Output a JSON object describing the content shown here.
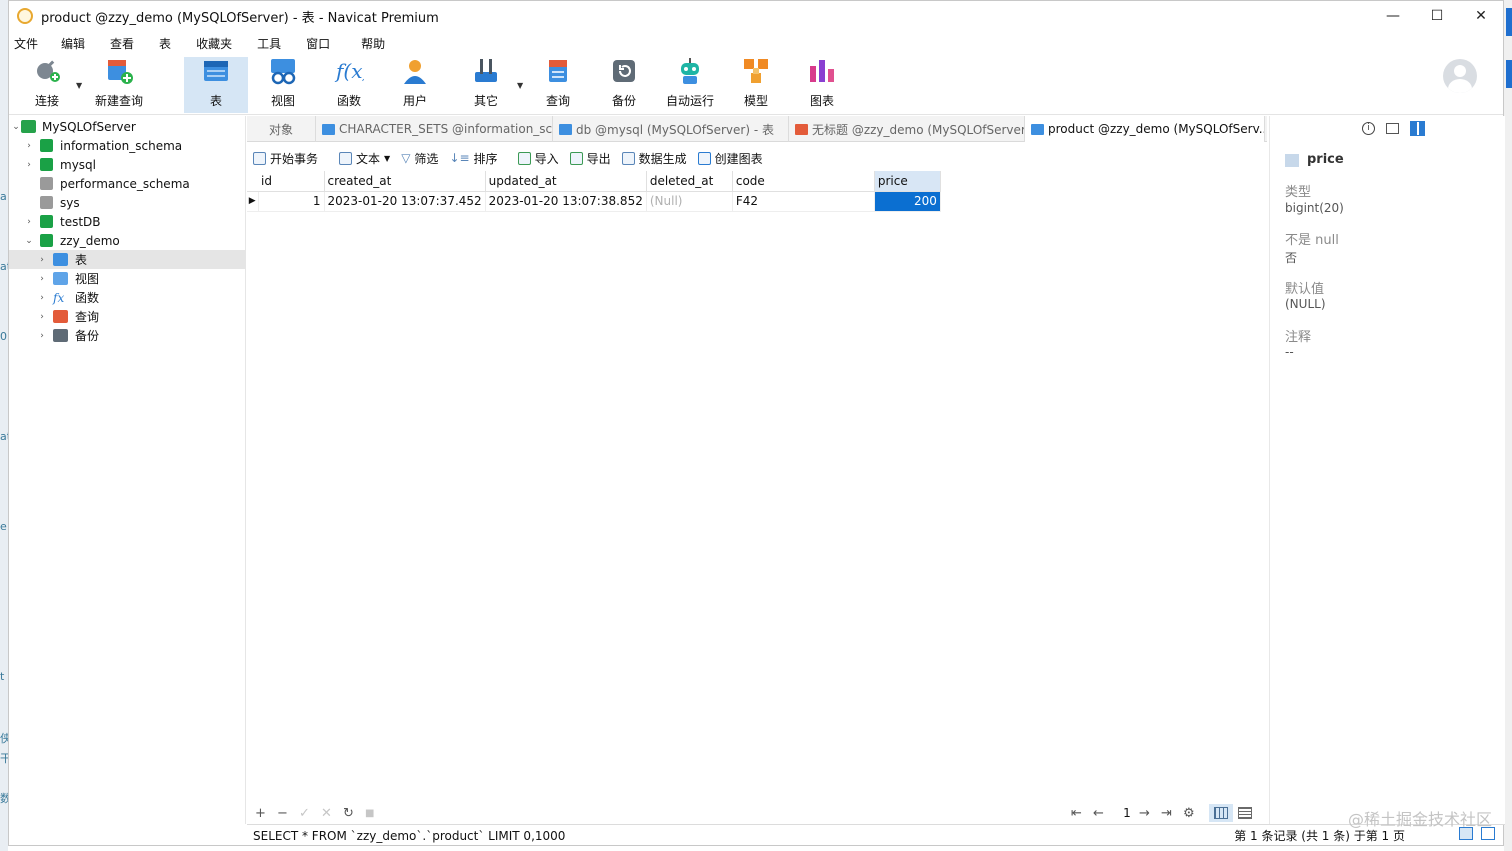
{
  "window": {
    "title": "product @zzy_demo (MySQLOfServer) - 表 - Navicat Premium",
    "minimize": "—",
    "maximize": "☐",
    "close": "✕"
  },
  "menu": [
    "文件",
    "编辑",
    "查看",
    "表",
    "收藏夹",
    "工具",
    "窗口",
    "帮助"
  ],
  "toolbar": {
    "connect": "连接",
    "new_query": "新建查询",
    "table": "表",
    "view": "视图",
    "function": "函数",
    "user": "用户",
    "other": "其它",
    "query": "查询",
    "backup": "备份",
    "auto_run": "自动运行",
    "model": "模型",
    "chart": "图表"
  },
  "tree": {
    "server": "MySQLOfServer",
    "databases": [
      "information_schema",
      "mysql",
      "performance_schema",
      "sys",
      "testDB",
      "zzy_demo"
    ],
    "children": [
      "表",
      "视图",
      "函数",
      "查询",
      "备份"
    ]
  },
  "tabs": [
    "对象",
    "CHARACTER_SETS @information_sch...",
    "db @mysql (MySQLOfServer) - 表",
    "无标题 @zzy_demo (MySQLOfServer)...",
    "product @zzy_demo (MySQLOfServ..."
  ],
  "subtoolbar": {
    "begin_tx": "开始事务",
    "text": "文本",
    "filter": "筛选",
    "sort": "排序",
    "import": "导入",
    "export": "导出",
    "data_gen": "数据生成",
    "create_chart": "创建图表"
  },
  "grid": {
    "columns": [
      "id",
      "created_at",
      "updated_at",
      "deleted_at",
      "code",
      "price"
    ],
    "rows": [
      [
        "1",
        "2023-01-20 13:07:37.452",
        "2023-01-20 13:07:38.852",
        "(Null)",
        "F42",
        "200"
      ]
    ]
  },
  "nav": {
    "add": "+",
    "remove": "−",
    "apply": "✓",
    "discard": "✕",
    "refresh": "↻",
    "stop": "■",
    "first": "⇤",
    "prev": "←",
    "page": "1",
    "next": "→",
    "last": "⇥",
    "settings": "⚙"
  },
  "status": {
    "sql": "SELECT * FROM `zzy_demo`.`product` LIMIT 0,1000",
    "record_info": "第 1 条记录 (共 1 条) 于第 1 页"
  },
  "right_panel": {
    "field_name": "price",
    "type_label": "类型",
    "type_value": "bigint(20)",
    "notnull_label": "不是 null",
    "notnull_value": "否",
    "default_label": "默认值",
    "default_value": "(NULL)",
    "comment_label": "注释",
    "comment_value": "--"
  },
  "watermark": "@稀土掘金技术社区",
  "colors": {
    "selection": "#0b6fd1",
    "active_toolbar": "#d6e6f5",
    "db_green": "#1aa146"
  }
}
